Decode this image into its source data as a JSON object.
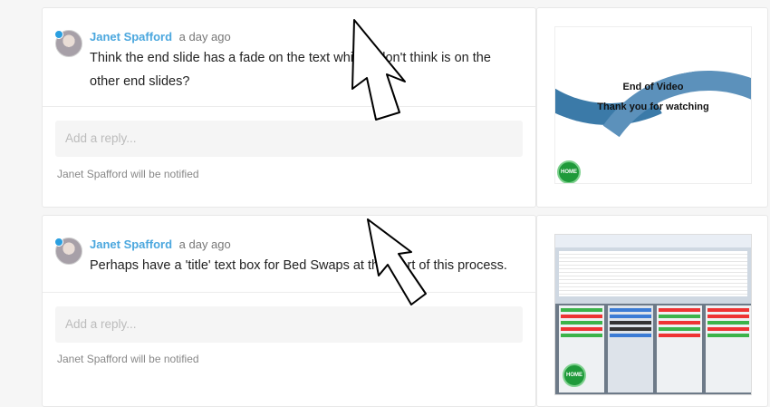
{
  "comments": [
    {
      "author": "Janet Spafford",
      "time": "a day ago",
      "text": "Think the end slide has a fade on the text which I don't think is on the other end slides?",
      "reply_placeholder": "Add a reply...",
      "notice": "Janet Spafford will be notified",
      "thumbnail": {
        "title": "End of Video",
        "subtitle": "Thank you for watching",
        "home_label": "HOME"
      }
    },
    {
      "author": "Janet Spafford",
      "time": "a day ago",
      "text": "Perhaps have a 'title' text box for Bed Swaps at the start of this process.",
      "reply_placeholder": "Add a reply...",
      "notice": "Janet Spafford will be notified",
      "thumbnail": {
        "home_label": "HOME"
      }
    }
  ],
  "colors": {
    "author": "#4ba7de",
    "home_button": "#1f9a3a"
  }
}
